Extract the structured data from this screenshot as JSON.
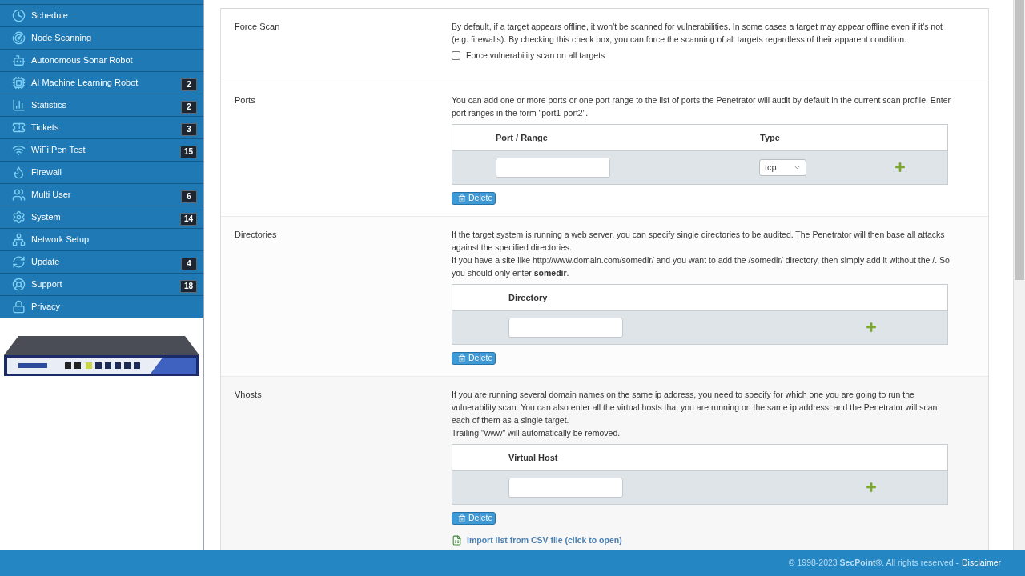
{
  "sidebar": {
    "items": [
      {
        "label": "Schedule"
      },
      {
        "label": "Node Scanning"
      },
      {
        "label": "Autonomous Sonar Robot"
      },
      {
        "label": "AI Machine Learning Robot",
        "badge": "2"
      },
      {
        "label": "Statistics",
        "badge": "2"
      },
      {
        "label": "Tickets",
        "badge": "3"
      },
      {
        "label": "WiFi Pen Test",
        "badge": "15"
      },
      {
        "label": "Firewall"
      },
      {
        "label": "Multi User",
        "badge": "6"
      },
      {
        "label": "System",
        "badge": "14"
      },
      {
        "label": "Network Setup"
      },
      {
        "label": "Update",
        "badge": "4"
      },
      {
        "label": "Support",
        "badge": "18"
      },
      {
        "label": "Privacy"
      }
    ]
  },
  "sections": [
    {
      "label": "Force Scan",
      "paragraphs": [
        "By default, if a target appears offline, it won't be scanned for vulnerabilities. In some cases a target may appear offline even if it's not (e.g. firewalls). By checking this check box, you can force the scanning of all targets regardless of their apparent condition."
      ],
      "checkbox": {
        "label": "Force vulnerability scan on all targets",
        "checked": false
      }
    },
    {
      "label": "Ports",
      "paragraphs": [
        "You can add one or more ports or one port range to the list of ports the Penetrator will audit by default in the current scan profile. Enter port ranges in the form \"port1-port2\"."
      ],
      "table": {
        "columns": [
          "Port / Range",
          "Type"
        ],
        "select": "tcp"
      },
      "delete_button": "Delete"
    },
    {
      "label": "Directories",
      "paragraphs": [
        "If the target system is running a web server, you can specify single directories to be audited. The Penetrator will then base all attacks against the specified directories.",
        "If you have a site like http://www.domain.com/somedir/ and you want to add the /somedir/ directory, then simply add it without the /. So you should only enter **somedir**."
      ],
      "table": {
        "columns": [
          "Directory"
        ]
      },
      "delete_button": "Delete"
    },
    {
      "label": "Vhosts",
      "paragraphs": [
        "If you are running several domain names on the same ip address, you need to specify for which one you are going to run the vulnerability scan. You can also enter all the virtual hosts that you are running on the same ip address, and the Penetrator will scan each of them as a single target.",
        "Trailing \"www\" will automatically be removed."
      ],
      "table": {
        "columns": [
          "Virtual Host"
        ]
      },
      "delete_button": "Delete",
      "import_link": "Import list from CSV file (click to open)"
    }
  ],
  "footer": {
    "text": "© 1998-2023 **SecPoint®**. All rights reserved -",
    "link": "Disclaimer"
  }
}
